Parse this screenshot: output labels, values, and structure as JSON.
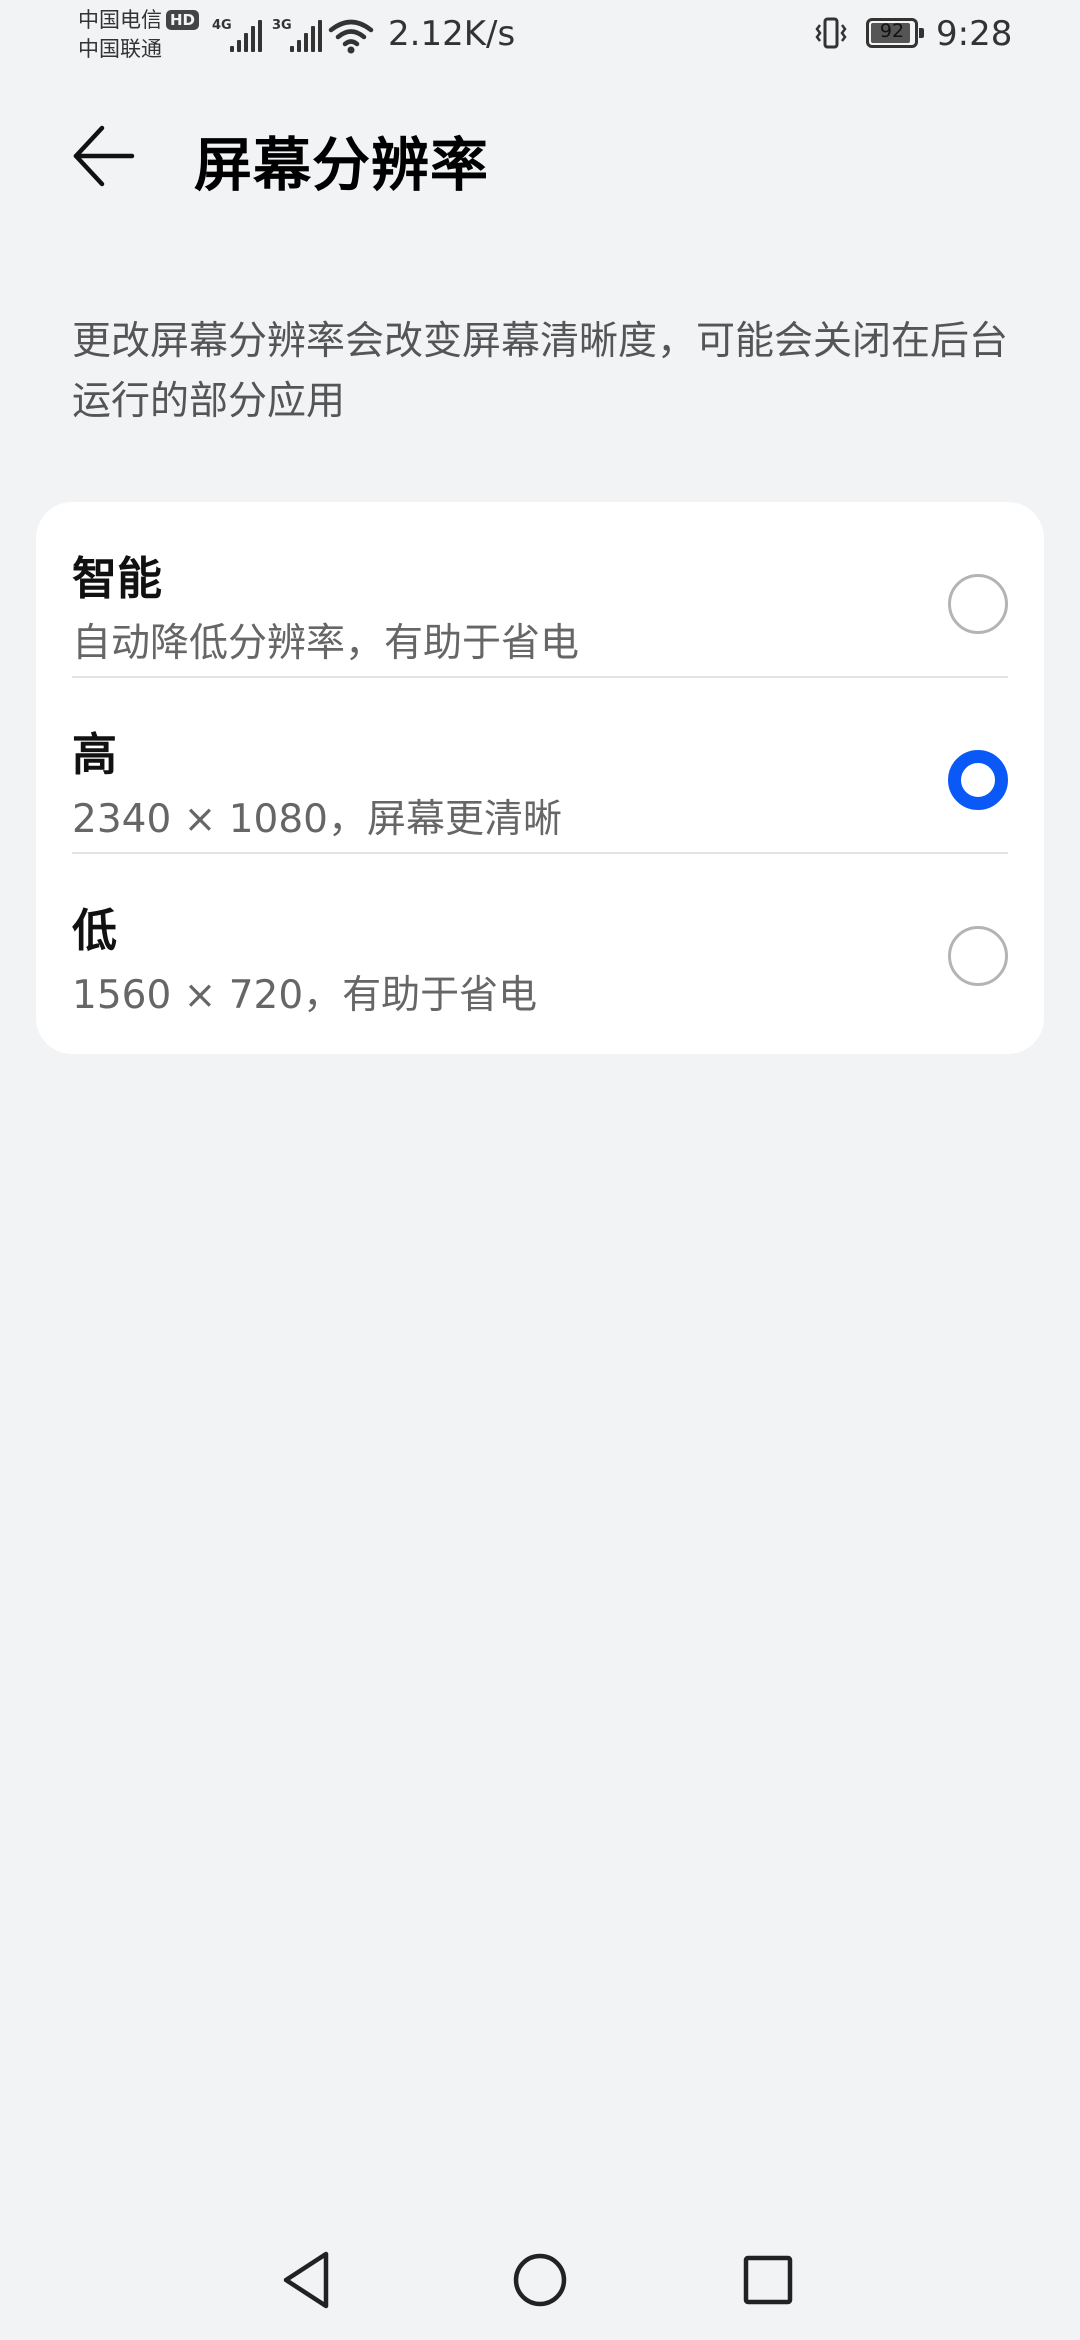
{
  "status_bar": {
    "carrier1": "中国电信",
    "hd_badge": "HD",
    "carrier2": "中国联通",
    "net1": "4G",
    "net2": "3G",
    "speed": "2.12K/s",
    "battery": "92",
    "battery_level": 0.92,
    "time": "9:28"
  },
  "header": {
    "title": "屏幕分辨率"
  },
  "description": "更改屏幕分辨率会改变屏幕清晰度，可能会关闭在后台运行的部分应用",
  "options": [
    {
      "title": "智能",
      "subtitle": "自动降低分辨率，有助于省电",
      "selected": false
    },
    {
      "title": "高",
      "subtitle": "2340 × 1080，屏幕更清晰",
      "selected": true
    },
    {
      "title": "低",
      "subtitle": "1560 × 720，有助于省电",
      "selected": false
    }
  ],
  "colors": {
    "accent": "#0a59f7",
    "background": "#f1f3f5",
    "card": "#ffffff"
  },
  "icons": {
    "back": "back-arrow-icon",
    "nav_back": "triangle-back-icon",
    "nav_home": "circle-home-icon",
    "nav_recent": "square-recent-icon"
  }
}
